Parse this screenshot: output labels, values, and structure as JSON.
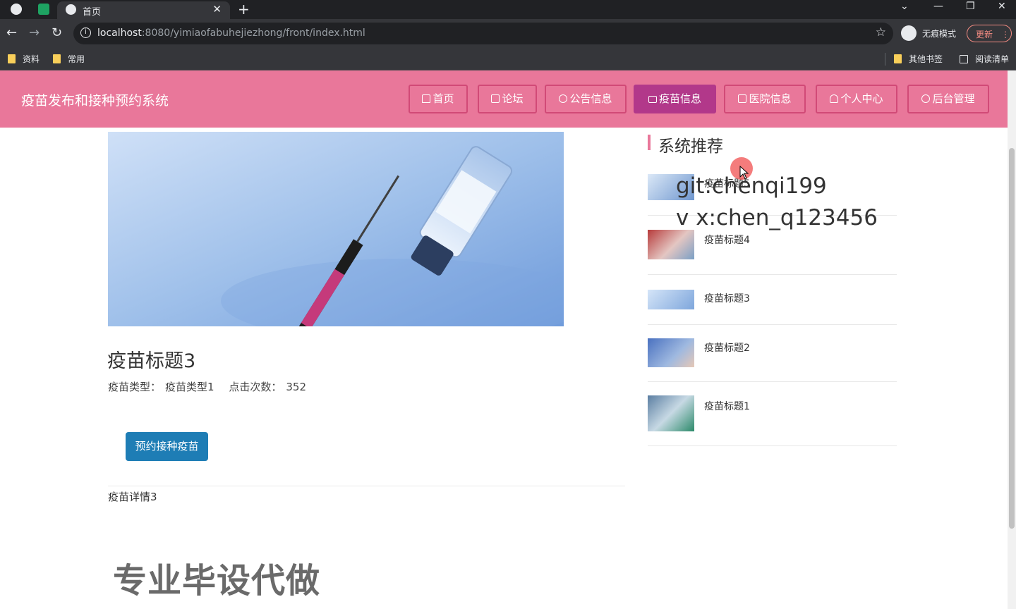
{
  "browser": {
    "tab_title": "首页",
    "url_host": "localhost",
    "url_rest": ":8080/yimiaofabuhejiezhong/front/index.html",
    "incognito_label": "无痕模式",
    "update_label": "更新",
    "bookmarks": [
      "资料",
      "常用"
    ],
    "bookmarks_right": [
      "其他书签",
      "阅读清单"
    ]
  },
  "site": {
    "title": "疫苗发布和接种预约系统",
    "nav": [
      {
        "label": "首页",
        "icon": "home-icon",
        "active": false
      },
      {
        "label": "论坛",
        "icon": "forum-icon",
        "active": false
      },
      {
        "label": "公告信息",
        "icon": "notice-icon",
        "active": false
      },
      {
        "label": "疫苗信息",
        "icon": "mail-icon",
        "active": true
      },
      {
        "label": "医院信息",
        "icon": "hospital-icon",
        "active": false
      },
      {
        "label": "个人中心",
        "icon": "user-icon",
        "active": false
      },
      {
        "label": "后台管理",
        "icon": "link-icon",
        "active": false
      }
    ],
    "accent_color": "#e9779a"
  },
  "detail": {
    "image_label": "疫苗",
    "title": "疫苗标题3",
    "type_label": "疫苗类型：",
    "type_value": "疫苗类型1",
    "clicks_label": "点击次数：",
    "clicks_value": "352",
    "book_button": "预约接种疫苗",
    "body": "疫苗详情3"
  },
  "recommend": {
    "heading": "系统推荐",
    "items": [
      {
        "title": "疫苗标题5"
      },
      {
        "title": "疫苗标题4"
      },
      {
        "title": "疫苗标题3"
      },
      {
        "title": "疫苗标题2"
      },
      {
        "title": "疫苗标题1"
      }
    ]
  },
  "overlay": {
    "line1": "git:chenqi199",
    "line2": "v x:chen_q123456",
    "banner": "专业毕设代做"
  }
}
